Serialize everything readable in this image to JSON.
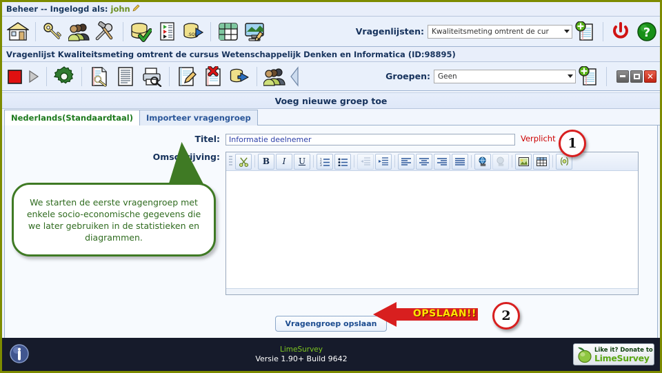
{
  "admin_bar": {
    "title": "Beheer -- Ingelogd als:",
    "user": "john",
    "edit_icon": "pencil-icon"
  },
  "toolbar_main": {
    "icons": [
      {
        "name": "home-icon",
        "title": "Home"
      },
      {
        "name": "key-icon",
        "title": "Gebruikersrechten"
      },
      {
        "name": "users-icon",
        "title": "Gebruikersbeheer"
      },
      {
        "name": "tools-icon",
        "title": "Instellingen"
      },
      {
        "name": "database-check-icon",
        "title": "Database controle"
      },
      {
        "name": "document-list-icon",
        "title": "Labelsets"
      },
      {
        "name": "database-sql-icon",
        "title": "SQL"
      },
      {
        "name": "grid-icon",
        "title": "Tabel"
      },
      {
        "name": "template-editor-icon",
        "title": "Templates"
      }
    ],
    "survey_select_label": "Vragenlijsten:",
    "survey_select_value": "Kwaliteitsmeting omtrent de cur",
    "add_survey_icon": "add-document-icon",
    "logout_icon": "power-icon",
    "help_icon": "help-icon"
  },
  "survey_title": "Vragenlijst Kwaliteitsmeting omtrent de cursus Wetenschappelijk Denken en Informatica (ID:98895)",
  "toolbar_survey": {
    "icons": [
      {
        "name": "stop-icon",
        "title": "Vragenlijst niet actief"
      },
      {
        "name": "play-icon",
        "title": "Activeer vragenlijst"
      },
      {
        "name": "gear-icon",
        "title": "Eigenschappen"
      },
      {
        "name": "document-key-icon",
        "title": "Vragenlijst rechten"
      },
      {
        "name": "document-text-icon",
        "title": "Vragenlijst tekstelementen"
      },
      {
        "name": "print-preview-icon",
        "title": "Afdrukvoorbeeld"
      },
      {
        "name": "document-edit-icon",
        "title": "Bewerk vragenlijst"
      },
      {
        "name": "document-delete-icon",
        "title": "Verwijder vragenlijst"
      },
      {
        "name": "database-export-icon",
        "title": "Exporteer"
      },
      {
        "name": "participants-icon",
        "title": "Deelnemers"
      },
      {
        "name": "collapse-icon",
        "title": "Inklappen"
      }
    ],
    "group_select_label": "Groepen:",
    "group_select_value": "Geen",
    "add_group_icon": "add-document-icon"
  },
  "window_controls": {
    "minimize": "minimize-button",
    "maximize": "maximize-button",
    "close": "close-button",
    "close_glyph": "✕"
  },
  "page_heading": "Voeg nieuwe groep toe",
  "tabs": [
    {
      "label": "Nederlands(Standaardtaal)",
      "active": true
    },
    {
      "label": "Importeer vragengroep",
      "active": false
    }
  ],
  "form": {
    "title_label": "Titel:",
    "title_value": "Informatie deelnemer",
    "title_placeholder": "",
    "required_note": "Verplicht",
    "description_label": "Omschrijving:",
    "description_value": "",
    "save_button": "Vragengroep opslaan"
  },
  "editor_toolbar": {
    "buttons": [
      {
        "name": "cut-icon",
        "glyph": "✂"
      },
      {
        "name": "bold-icon",
        "glyph": "B"
      },
      {
        "name": "italic-icon",
        "glyph": "I"
      },
      {
        "name": "underline-icon",
        "glyph": "U"
      },
      {
        "name": "numbered-list-icon",
        "glyph": ""
      },
      {
        "name": "bullet-list-icon",
        "glyph": ""
      },
      {
        "name": "outdent-icon",
        "glyph": ""
      },
      {
        "name": "indent-icon",
        "glyph": ""
      },
      {
        "name": "align-left-icon",
        "glyph": ""
      },
      {
        "name": "align-center-icon",
        "glyph": ""
      },
      {
        "name": "align-right-icon",
        "glyph": ""
      },
      {
        "name": "align-justify-icon",
        "glyph": ""
      },
      {
        "name": "link-icon",
        "glyph": ""
      },
      {
        "name": "unlink-icon",
        "glyph": ""
      },
      {
        "name": "image-icon",
        "glyph": ""
      },
      {
        "name": "table-icon",
        "glyph": ""
      },
      {
        "name": "source-code-icon",
        "glyph": "{;}"
      }
    ]
  },
  "callout": {
    "text": "We starten de eerste vragengroep met enkele socio-economische gegevens die we later gebruiken in de statistieken en diagrammen.",
    "border_color": "#3f7a24",
    "text_color": "#2f6b1f"
  },
  "annotations": {
    "marker_one": "1",
    "marker_two": "2",
    "arrow_label": "OPSLAAN!!",
    "arrow_color": "#d81f1f",
    "arrow_label_color": "#ffe400"
  },
  "footer": {
    "info_icon": "info-icon",
    "product": "LimeSurvey",
    "version": "Versie 1.90+ Build 9642",
    "donate_top": "Like it? Donate to",
    "donate_bottom": "LimeSurvey"
  }
}
